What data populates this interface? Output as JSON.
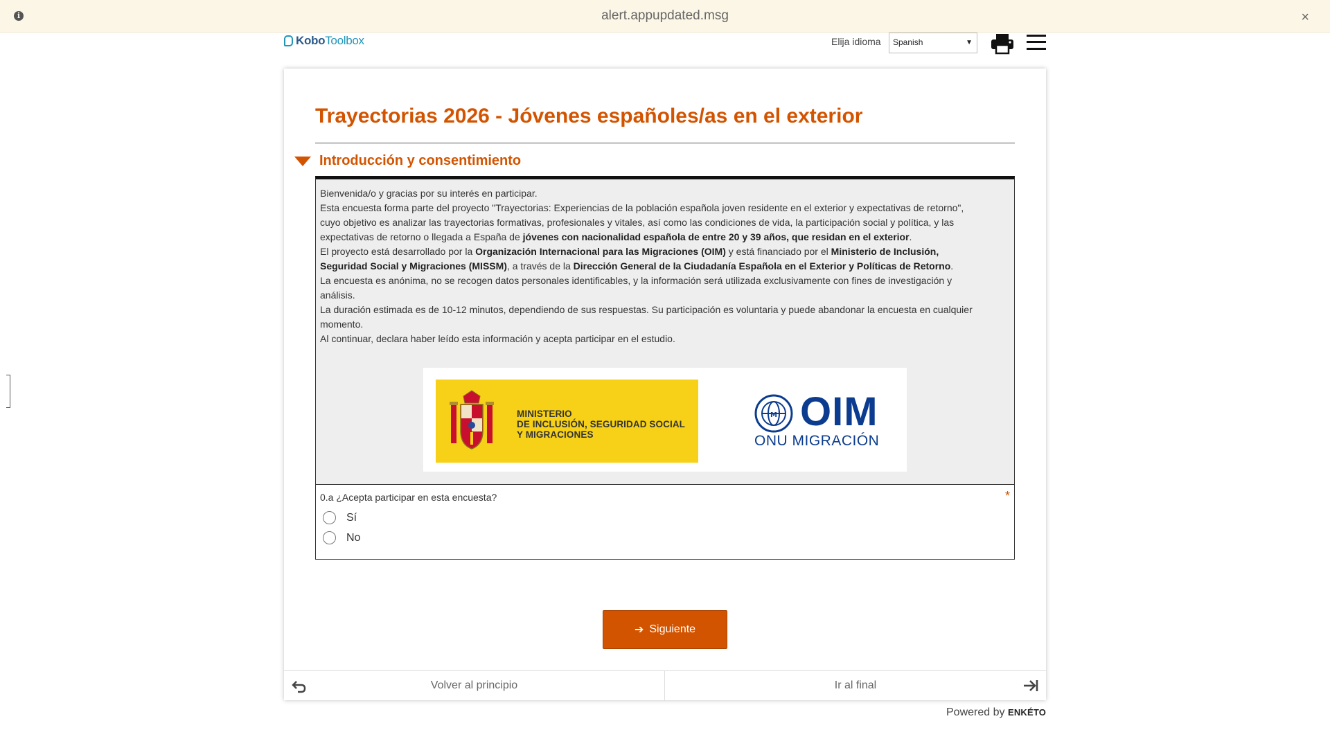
{
  "alert": {
    "message": "alert.appupdated.msg",
    "close_label": "×"
  },
  "header": {
    "logo_text_a": "Kobo",
    "logo_text_b": "Toolbox",
    "language_label": "Elija idioma",
    "language_selected": "Spanish"
  },
  "form": {
    "title": "Trayectorias 2026 - Jóvenes españoles/as en el exterior",
    "group_title": "Introducción y consentimiento",
    "intro": {
      "p1": "Bienvenida/o y gracias por su interés en participar.",
      "p2_a": "Esta encuesta forma parte del proyecto \"Trayectorias: Experiencias de la población española joven residente en el exterior y expectativas de retorno\", cuyo objetivo es analizar las trayectorias formativas, profesionales y vitales, así como las condiciones de vida, la participación social y política, y las expectativas de retorno o llegada a España de ",
      "p2_b": "jóvenes con nacionalidad española de entre 20 y 39 años, que residan en el exterior",
      "p2_c": ".",
      "p3_a": "El proyecto está desarrollado por la ",
      "p3_b": "Organización Internacional para las Migraciones (OIM)",
      "p3_c": " y está financiado por el ",
      "p3_d": "Ministerio de Inclusión, Seguridad Social y Migraciones (MISSM)",
      "p3_e": ", a través de la ",
      "p3_f": "Dirección General de la Ciudadanía Española en el Exterior y Políticas de Retorno",
      "p3_g": ".",
      "p4": "La encuesta es anónima, no se recogen datos personales identificables, y la información será utilizada exclusivamente con fines de investigación y análisis.",
      "p5": "La duración estimada es de 10-12 minutos, dependiendo de sus respuestas. Su participación es voluntaria y puede abandonar la encuesta en cualquier momento.",
      "p6": "Al continuar, declara haber leído esta información y acepta participar en el estudio."
    },
    "logos": {
      "ministry_line1": "MINISTERIO",
      "ministry_line2": "DE INCLUSIÓN, SEGURIDAD SOCIAL",
      "ministry_line3": "Y MIGRACIONES",
      "oim_letters": "OIM",
      "oim_sub": "ONU MIGRACIÓN"
    },
    "question": {
      "label": "0.a ¿Acepta participar en esta encuesta?",
      "required_mark": "*",
      "options": [
        "Sí",
        "No"
      ]
    },
    "next_label": "Siguiente",
    "nav": {
      "back_label": "Volver al principio",
      "end_label": "Ir al final"
    }
  },
  "footer": {
    "powered_by": "Powered by",
    "brand": "ENKÉTO"
  },
  "colors": {
    "accent": "#d35400",
    "alert_bg": "#fcf6e6",
    "note_bg": "#eeeeee",
    "ministry_yellow": "#f7d117",
    "oim_blue": "#0b3c8f"
  }
}
